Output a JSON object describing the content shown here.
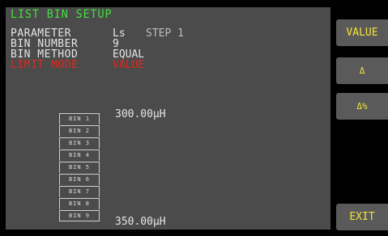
{
  "title": "LIST BIN SETUP",
  "params": [
    {
      "label": "PARAMETER",
      "value": "Ls",
      "extra": "STEP 1"
    },
    {
      "label": "BIN NUMBER",
      "value": "9"
    },
    {
      "label": "BIN METHOD",
      "value": "EQUAL"
    },
    {
      "label": "LIMIT MODE",
      "value": "VALUE"
    }
  ],
  "range": {
    "top": "300.00μH",
    "bottom": "350.00μH"
  },
  "bins": [
    "BIN 1",
    "BIN 2",
    "BIN 3",
    "BIN 4",
    "BIN 5",
    "BIN 6",
    "BIN 7",
    "BIN 8",
    "BIN 9"
  ],
  "softkeys": {
    "value": "VALUE",
    "delta": "Δ",
    "delta_pct": "Δ%",
    "exit": "EXIT"
  },
  "colors": {
    "background": "#4b4b4b",
    "title": "#41e33c",
    "highlight": "#e0281c",
    "softkey_text": "#f5e23a"
  }
}
